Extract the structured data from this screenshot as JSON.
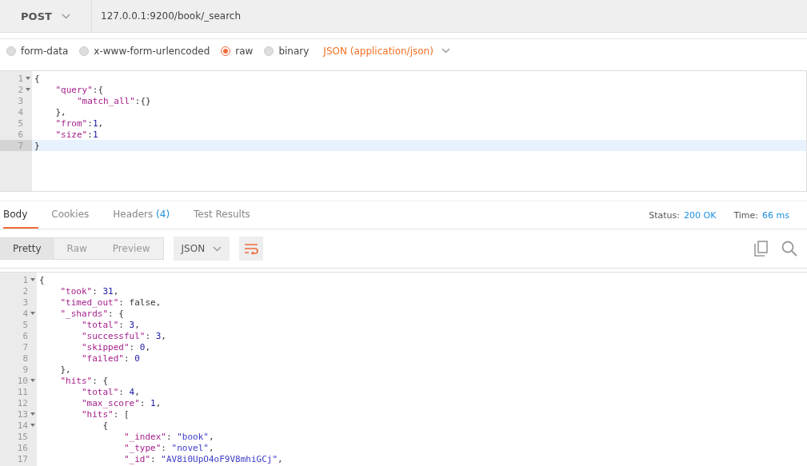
{
  "request": {
    "method": "POST",
    "url": "127.0.0.1:9200/book/_search"
  },
  "body_types": [
    {
      "label": "form-data",
      "selected": false
    },
    {
      "label": "x-www-form-urlencoded",
      "selected": false
    },
    {
      "label": "raw",
      "selected": true
    },
    {
      "label": "binary",
      "selected": false
    }
  ],
  "content_type": "JSON (application/json)",
  "request_body": [
    {
      "number": "1",
      "text": "{",
      "foldable": true,
      "active": false
    },
    {
      "number": "2",
      "text": "    \"query\":{",
      "foldable": true,
      "active": false
    },
    {
      "number": "3",
      "text": "        \"match_all\":{}",
      "foldable": false,
      "active": false
    },
    {
      "number": "4",
      "text": "    },",
      "foldable": false,
      "active": false
    },
    {
      "number": "5",
      "text": "    \"from\":1,",
      "foldable": false,
      "active": false
    },
    {
      "number": "6",
      "text": "    \"size\":1",
      "foldable": false,
      "active": false
    },
    {
      "number": "7",
      "text": "}",
      "foldable": false,
      "active": true
    }
  ],
  "response_tabs": [
    {
      "label": "Body",
      "selected": true
    },
    {
      "label": "Cookies",
      "selected": false
    },
    {
      "label": "Headers",
      "count": "(4)",
      "selected": false
    },
    {
      "label": "Test Results",
      "selected": false
    }
  ],
  "status": {
    "label": "Status:",
    "value": "200 OK"
  },
  "time": {
    "label": "Time:",
    "value": "66 ms"
  },
  "view_modes": [
    {
      "label": "Pretty",
      "selected": true
    },
    {
      "label": "Raw",
      "selected": false
    },
    {
      "label": "Preview",
      "selected": false
    }
  ],
  "format": "JSON",
  "response_body": [
    {
      "number": "1",
      "text": "{",
      "foldable": true
    },
    {
      "number": "2",
      "text": "    \"took\": 31,",
      "foldable": false
    },
    {
      "number": "3",
      "text": "    \"timed_out\": false,",
      "foldable": false
    },
    {
      "number": "4",
      "text": "    \"_shards\": {",
      "foldable": true
    },
    {
      "number": "5",
      "text": "        \"total\": 3,",
      "foldable": false
    },
    {
      "number": "6",
      "text": "        \"successful\": 3,",
      "foldable": false
    },
    {
      "number": "7",
      "text": "        \"skipped\": 0,",
      "foldable": false
    },
    {
      "number": "8",
      "text": "        \"failed\": 0",
      "foldable": false
    },
    {
      "number": "9",
      "text": "    },",
      "foldable": false
    },
    {
      "number": "10",
      "text": "    \"hits\": {",
      "foldable": true
    },
    {
      "number": "11",
      "text": "        \"total\": 4,",
      "foldable": false
    },
    {
      "number": "12",
      "text": "        \"max_score\": 1,",
      "foldable": false
    },
    {
      "number": "13",
      "text": "        \"hits\": [",
      "foldable": true
    },
    {
      "number": "14",
      "text": "            {",
      "foldable": true
    },
    {
      "number": "15",
      "text": "                \"_index\": \"book\",",
      "foldable": false
    },
    {
      "number": "16",
      "text": "                \"_type\": \"novel\",",
      "foldable": false
    },
    {
      "number": "17",
      "text": "                \"_id\": \"AV8i0UpO4oF9V8mhiGCj\",",
      "foldable": false
    }
  ]
}
